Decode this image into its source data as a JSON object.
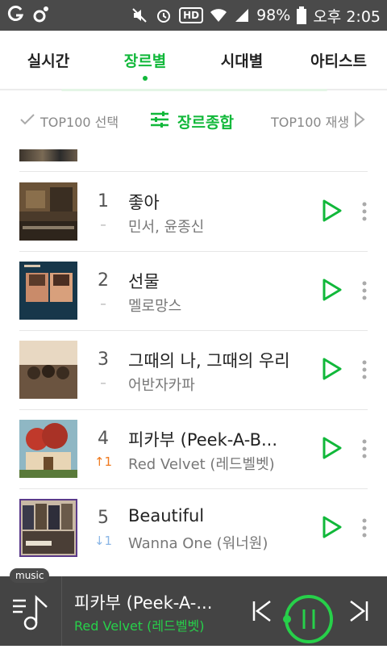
{
  "statusbar": {
    "battery": "98%",
    "time": "오후 2:05",
    "hd_label": "HD"
  },
  "tabs": [
    {
      "label": "실시간",
      "active": false
    },
    {
      "label": "장르별",
      "active": true
    },
    {
      "label": "시대별",
      "active": false
    },
    {
      "label": "아티스트",
      "active": false
    }
  ],
  "toolbar": {
    "select_label": "TOP100 선택",
    "genre_label": "장르종합",
    "play_label": "TOP100 재생"
  },
  "chart": [
    {
      "rank": "1",
      "change": "–",
      "change_type": "same",
      "title": "좋아",
      "artist": "민서, 윤종신"
    },
    {
      "rank": "2",
      "change": "–",
      "change_type": "same",
      "title": "선물",
      "artist": "멜로망스"
    },
    {
      "rank": "3",
      "change": "–",
      "change_type": "same",
      "title": "그때의 나, 그때의 우리",
      "artist": "어반자카파"
    },
    {
      "rank": "4",
      "change": "↑1",
      "change_type": "up",
      "title": "피카부 (Peek-A-B...",
      "artist": "Red Velvet (레드벨벳)"
    },
    {
      "rank": "5",
      "change": "↓1",
      "change_type": "down",
      "title": "Beautiful",
      "artist": "Wanna One (워너원)"
    }
  ],
  "player": {
    "badge": "music",
    "title": "피카부 (Peek-A-...",
    "artist": "Red Velvet (레드벨벳)",
    "progress": 0.05
  },
  "colors": {
    "accent": "#11b83a",
    "up": "#f07a1f",
    "down": "#8ab6e6",
    "statusbar": "#4a4a4a"
  }
}
